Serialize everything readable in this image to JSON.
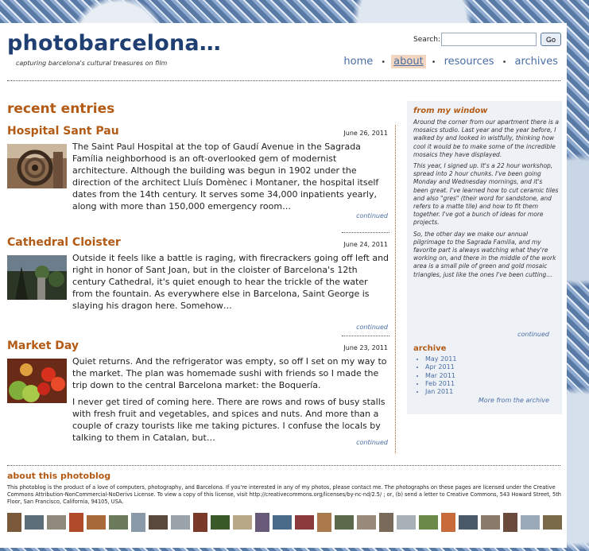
{
  "header": {
    "title": "photobarcelona…",
    "tagline": "capturing barcelona's cultural treasures on film",
    "search_label": "Search:",
    "go_label": "Go"
  },
  "nav": [
    "home",
    "about",
    "resources",
    "archives"
  ],
  "nav_active": "about",
  "main": {
    "section_title": "recent entries",
    "entries": [
      {
        "title": "Hospital Sant Pau",
        "date": "June 26, 2011",
        "paragraphs": [
          "The Saint Paul Hospital at the top of Gaudí Avenue in the Sagrada Família neighborhood is an oft-overlooked gem of modernist architecture. Although the building was begun in 1902 under the direction of the architect Lluís Domènec i Montaner, the hospital itself dates from the 14th century. It serves some 34,000 inpatients yearly, along with more than 150,000 emergency room…"
        ],
        "continued": "continued"
      },
      {
        "title": "Cathedral Cloister",
        "date": "June 24, 2011",
        "paragraphs": [
          "Outside it feels like a battle is raging, with firecrackers going off left and right in honor of Sant Joan, but in the cloister of Barcelona's 12th century Cathedral, it's quiet enough to hear the trickle of the water from the fountain. As everywhere else in Barcelona, Saint George is slaying his dragon here. Somehow…"
        ],
        "continued": "continued"
      },
      {
        "title": "Market Day",
        "date": "June 23, 2011",
        "paragraphs": [
          "Quiet returns. And the refrigerator was empty, so off I set on my way to the market. The plan was homemade sushi with friends so I made the trip down to the central Barcelona market: the Boquería.",
          "I never get tired of coming here. There are rows and rows of busy stalls with fresh fruit and vegetables, and spices and nuts. And more than a couple of crazy tourists like me taking pictures. I confuse the locals by talking to them in Catalan, but…"
        ],
        "continued": "continued"
      }
    ]
  },
  "sidebar": {
    "window_title": "from my window",
    "window_paragraphs": [
      "Around the corner from our apartment there is a mosaics studio. Last year and the year before, I walked by and looked in wistfully, thinking how cool it would be to make some of the incredible mosaics they have displayed.",
      "This year, I signed up. It's a 22 hour workshop, spread into 2 hour chunks. I've been going Monday and Wednesday mornings, and it's been great. I've learned how to cut ceramic tiles and also \"gres\" (their word for sandstone, and refers to a matte tile) and how to fit them together. I've got a bunch of ideas for more projects.",
      "So, the other day we make our annual pilgrimage to the Sagrada Familia, and my favorite part is always watching what they're working on, and there in the middle of the work area is a small pile of green and gold mosaic triangles, just like the ones I've been cutting…"
    ],
    "window_continued": "continued",
    "archive_title": "archive",
    "archive_items": [
      "May 2011",
      "Apr 2011",
      "Mar 2011",
      "Feb 2011",
      "Jan 2011"
    ],
    "more_archive": "More from the archive"
  },
  "footer": {
    "about_title": "about this photoblog",
    "about_text": "This photoblog is the product of a love of computers, photography, and Barcelona. If you're interested in any of my photos, please contact me. The photographs on these pages are licensed under the Creative Commons Attribution-NonCommercial-NoDerivs License. To view a copy of this license, visit http://creativecommons.org/licenses/by-nc-nd/2.5/ ; or, (b) send a letter to Creative Commons, 543 Howard Street, 5th Floor, San Francisco, California, 94105, USA."
  },
  "colors": {
    "title_blue": "#1f3f73",
    "accent_orange": "#b35a14",
    "link_blue": "#4a6da4",
    "sidebar_bg": "#eef2f7",
    "nav_active_bg": "#f3d6c0"
  }
}
